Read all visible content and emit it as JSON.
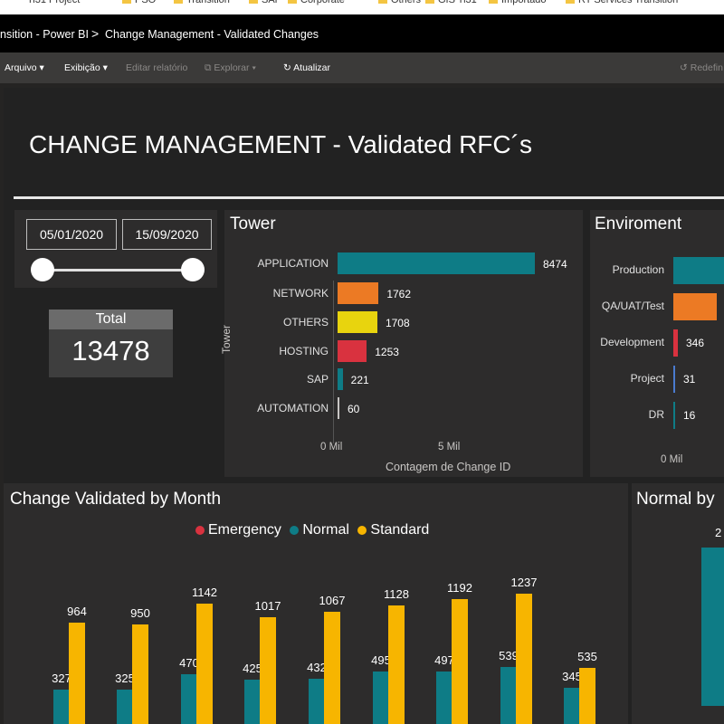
{
  "bookmarks": [
    "Ti31 Project",
    "PSO",
    "Transition",
    "SAP",
    "Corporate",
    "Others",
    "GIS Ti31",
    "Importado",
    "RT Services Transition"
  ],
  "titlebar": {
    "breadcrumb_1": "nsition - Power BI",
    "separator": ">",
    "breadcrumb_2": "Change Management - Validated Changes"
  },
  "menubar": {
    "file": "Arquivo",
    "view": "Exibição",
    "edit_report": "Editar relatório",
    "explore": "Explorar",
    "refresh": "Atualizar",
    "reset": "Redefin"
  },
  "report": {
    "title": "CHANGE MANAGEMENT - Validated RFC´s",
    "date_start": "05/01/2020",
    "date_end": "15/09/2020",
    "total_label": "Total",
    "total_value": "13478"
  },
  "colors": {
    "teal": "#0e7c86",
    "orange": "#ec7a24",
    "yellow": "#e8d40e",
    "red": "#d9323f",
    "gold": "#f7b500",
    "emergency": "#d9323f"
  },
  "chart_data": [
    {
      "type": "bar",
      "title": "Tower",
      "xlabel": "Contagem de Change ID",
      "ylabel": "Tower",
      "categories": [
        "APPLICATION",
        "NETWORK",
        "OTHERS",
        "HOSTING",
        "SAP",
        "AUTOMATION"
      ],
      "values": [
        8474,
        1762,
        1708,
        1253,
        221,
        60
      ],
      "value_labels": [
        "8474",
        "1762",
        "1708",
        "1253",
        "221",
        "60"
      ],
      "colors": [
        "#0e7c86",
        "#ec7a24",
        "#e8d40e",
        "#d9323f",
        "#0e7c86",
        "#c8c6c4"
      ],
      "xticks": [
        "0 Mil",
        "5 Mil"
      ],
      "xlim": [
        0,
        10000
      ]
    },
    {
      "type": "bar",
      "title": "Enviroment",
      "categories": [
        "Production",
        "QA/UAT/Test",
        "Development",
        "Project",
        "DR"
      ],
      "values": [
        null,
        null,
        346,
        31,
        16
      ],
      "value_labels": [
        "",
        "",
        "346",
        "31",
        "16"
      ],
      "colors": [
        "#0e7c86",
        "#ec7a24",
        "#d9323f",
        "#4a7bd0",
        "#0e7c86"
      ],
      "xticks": [
        "0 Mil"
      ]
    },
    {
      "type": "bar",
      "title": "Change Validated by Month",
      "series": [
        {
          "name": "Emergency",
          "color": "#d9323f",
          "values": []
        },
        {
          "name": "Normal",
          "color": "#0e7c86",
          "values": [
            327,
            325,
            470,
            425,
            432,
            495,
            497,
            539,
            345
          ]
        },
        {
          "name": "Standard",
          "color": "#f7b500",
          "values": [
            964,
            950,
            1142,
            1017,
            1067,
            1128,
            1192,
            1237,
            535
          ]
        }
      ],
      "ylim": [
        0,
        1400
      ]
    },
    {
      "type": "bar",
      "title": "Normal by",
      "value_labels": [
        "2"
      ]
    }
  ]
}
